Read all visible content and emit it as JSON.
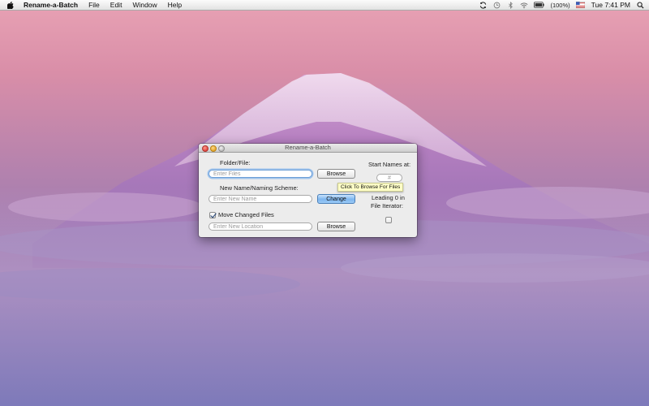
{
  "menubar": {
    "app_name": "Rename-a-Batch",
    "items": [
      "File",
      "Edit",
      "Window",
      "Help"
    ],
    "battery": "(100%)",
    "clock": "Tue 7:41 PM"
  },
  "window": {
    "title": "Rename-a-Batch",
    "folder_label": "Folder/File:",
    "files_placeholder": "Enter Files",
    "browse_label": "Browse",
    "new_name_label": "New Name/Naming Scheme:",
    "new_name_placeholder": "Enter New Name",
    "change_label": "Change",
    "move_files_label": "Move Changed Files",
    "move_files_checked": true,
    "location_placeholder": "Enter New Location",
    "browse2_label": "Browse",
    "start_names_label": "Start Names at:",
    "start_placeholder": "#",
    "leading_zero_label_1": "Leading 0 in",
    "leading_zero_label_2": "File Iterator:",
    "leading_zero_checked": false,
    "tooltip": "Click To Browse For Files"
  },
  "colors": {
    "default_button": "#7db6ef",
    "focus_ring": "#9fc3ec",
    "tooltip_bg": "#ffffc7"
  }
}
